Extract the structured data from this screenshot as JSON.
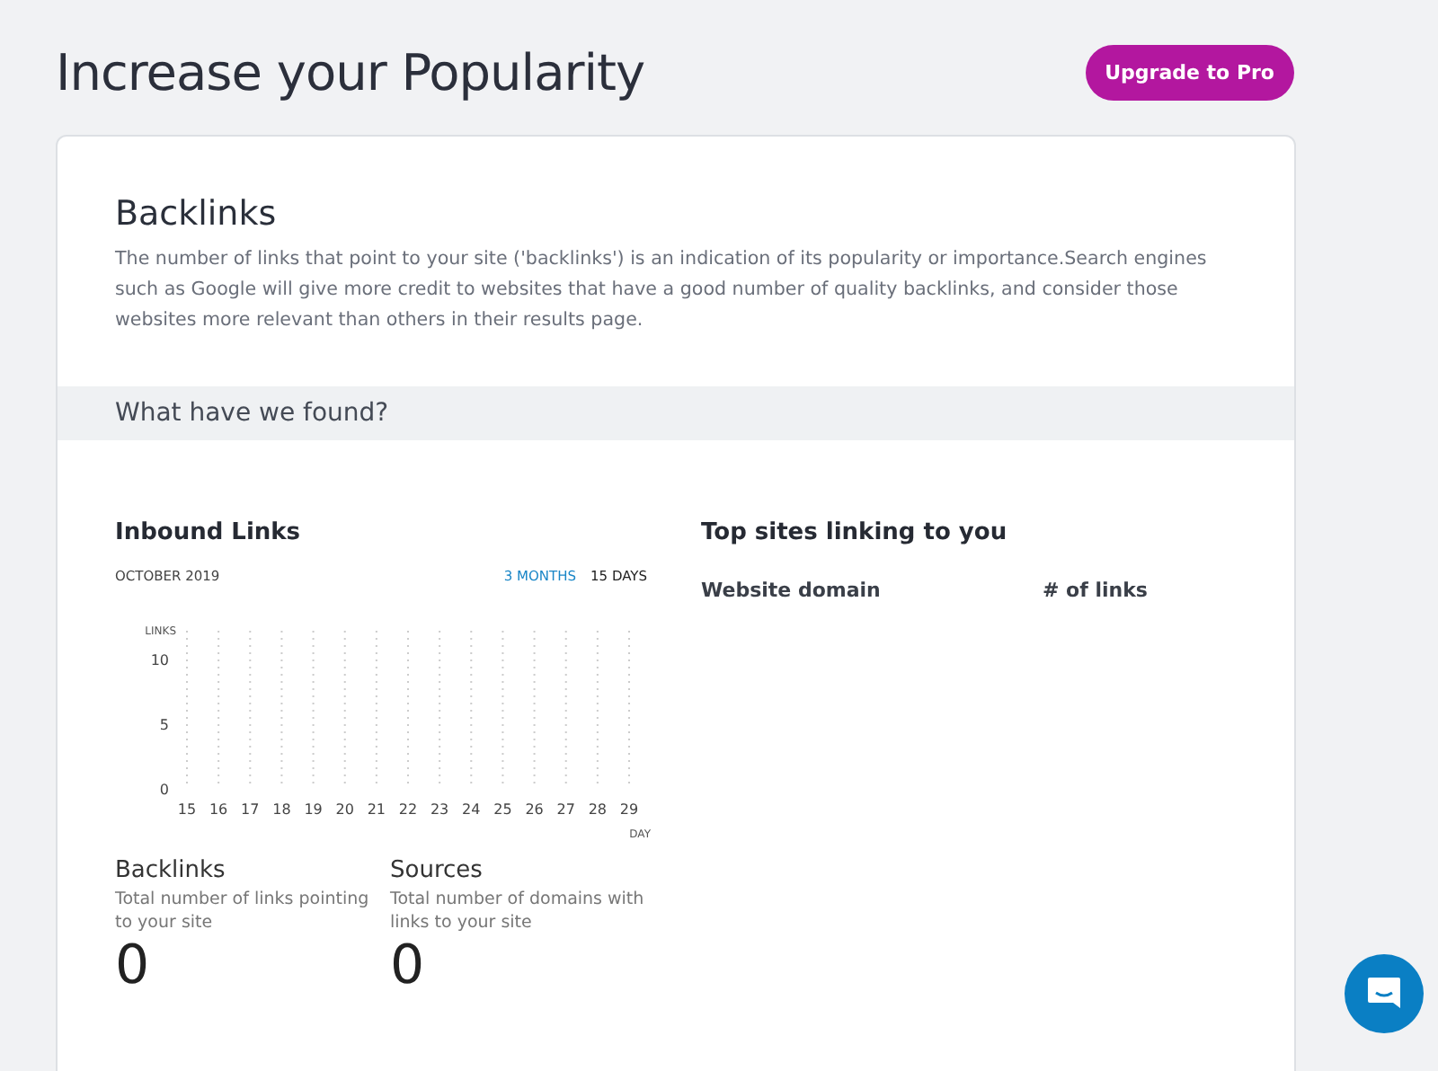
{
  "page_title": "Increase your Popularity",
  "upgrade_button": "Upgrade to Pro",
  "section": {
    "title": "Backlinks",
    "description": "The number of links that point to your site ('backlinks') is an indication of its popularity or importance.Search engines such as Google will give more credit to websites that have a good number of quality backlinks, and consider those websites more relevant than others in their results page."
  },
  "band_title": "What have we found?",
  "inbound": {
    "title": "Inbound Links",
    "period": "OCTOBER 2019",
    "ranges": [
      {
        "label": "3 MONTHS",
        "selected": false
      },
      {
        "label": "15 DAYS",
        "selected": true
      }
    ],
    "chart_data": {
      "type": "line",
      "xlabel": "DAY",
      "ylabel": "LINKS",
      "categories": [
        "15",
        "16",
        "17",
        "18",
        "19",
        "20",
        "21",
        "22",
        "23",
        "24",
        "25",
        "26",
        "27",
        "28",
        "29"
      ],
      "ylim": [
        0,
        10
      ],
      "yticks": [
        0,
        5,
        10
      ],
      "grid": true
    }
  },
  "stats": [
    {
      "title": "Backlinks",
      "description": "Total number of links pointing to your site",
      "value": "0"
    },
    {
      "title": "Sources",
      "description": "Total number of domains with links to your site",
      "value": "0"
    }
  ],
  "top_sites": {
    "title": "Top sites linking to you",
    "columns": [
      "Website domain",
      "# of links"
    ]
  }
}
